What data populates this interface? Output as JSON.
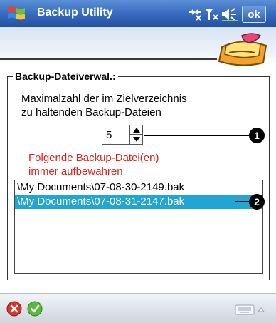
{
  "window": {
    "title": "Backup Utility",
    "ok_label": "ok"
  },
  "group": {
    "title": "Backup-Dateiverwal.:",
    "description_line1": "Maximalzahl der im Zielverzeichnis",
    "description_line2": "zu haltenden Backup-Dateien",
    "max_count": "5",
    "note_line1": "Folgende Backup-Datei(en)",
    "note_line2": "immer aufbewahren",
    "files": [
      {
        "name": "\\My Documents\\07-08-30-2149.bak",
        "selected": false
      },
      {
        "name": "\\My Documents\\07-08-31-2147.bak",
        "selected": true
      }
    ]
  },
  "callouts": {
    "first": "1",
    "second": "2"
  },
  "icons": {
    "start": "windows-flag-icon",
    "connectivity": "connectivity-icon",
    "signal": "signal-icon",
    "volume": "volume-icon",
    "logo": "backup-utility-logo",
    "cancel": "cancel-icon",
    "confirm": "confirm-icon",
    "keyboard": "keyboard-icon"
  },
  "colors": {
    "titlebar": "#2f5fb3",
    "selection": "#21a5d2",
    "note": "#e0201a"
  }
}
